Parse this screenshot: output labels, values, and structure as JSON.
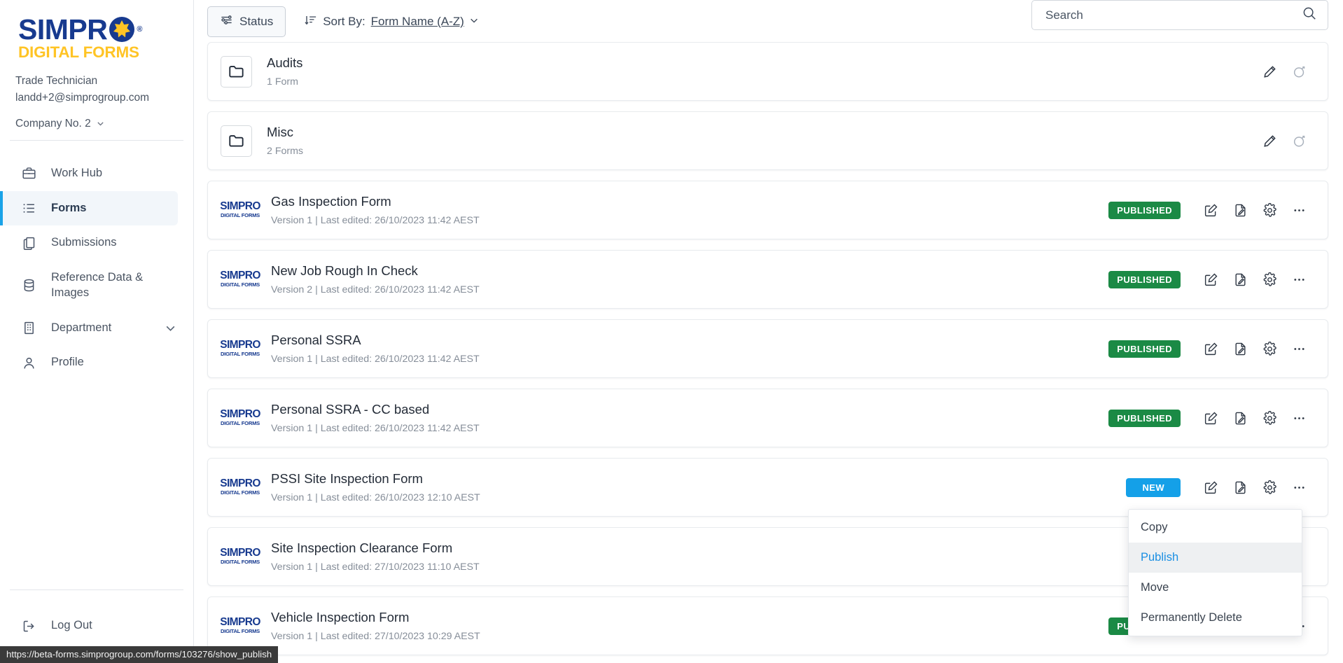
{
  "brand": {
    "name_top": "SIMPR",
    "name_reg": "®",
    "name_bottom": "DIGITAL FORMS"
  },
  "user": {
    "role": "Trade Technician",
    "email": "landd+2@simprogroup.com",
    "company": "Company No. 2"
  },
  "sidebar": {
    "items": [
      {
        "label": "Work Hub",
        "icon": "briefcase-icon",
        "active": false,
        "has_chevron": false
      },
      {
        "label": "Forms",
        "icon": "list-icon",
        "active": true,
        "has_chevron": false
      },
      {
        "label": "Submissions",
        "icon": "copy-documents-icon",
        "active": false,
        "has_chevron": false
      },
      {
        "label": "Reference Data & Images",
        "icon": "database-icon",
        "active": false,
        "has_chevron": false
      },
      {
        "label": "Department",
        "icon": "building-icon",
        "active": false,
        "has_chevron": true
      },
      {
        "label": "Profile",
        "icon": "user-icon",
        "active": false,
        "has_chevron": false
      }
    ],
    "logout": {
      "label": "Log Out",
      "icon": "logout-icon"
    }
  },
  "toolbar": {
    "status_label": "Status",
    "sort_label": "Sort By:",
    "sort_value": "Form Name (A-Z)"
  },
  "search": {
    "placeholder": "Search",
    "value": ""
  },
  "folders": [
    {
      "name": "Audits",
      "count": "1 Form"
    },
    {
      "name": "Misc",
      "count": "2 Forms"
    }
  ],
  "forms": [
    {
      "name": "Gas Inspection Form",
      "meta": "Version 1 | Last edited: 26/10/2023 11:42 AEST",
      "status": "PUBLISHED",
      "status_type": "published"
    },
    {
      "name": "New Job Rough In Check",
      "meta": "Version 2 | Last edited: 26/10/2023 11:42 AEST",
      "status": "PUBLISHED",
      "status_type": "published"
    },
    {
      "name": "Personal SSRA",
      "meta": "Version 1 | Last edited: 26/10/2023 11:42 AEST",
      "status": "PUBLISHED",
      "status_type": "published"
    },
    {
      "name": "Personal SSRA - CC based",
      "meta": "Version 1 | Last edited: 26/10/2023 11:42 AEST",
      "status": "PUBLISHED",
      "status_type": "published"
    },
    {
      "name": "PSSI Site Inspection Form",
      "meta": "Version 1 | Last edited: 26/10/2023 12:10 AEST",
      "status": "NEW",
      "status_type": "new"
    },
    {
      "name": "Site Inspection Clearance Form",
      "meta": "Version 1 | Last edited: 27/10/2023 11:10 AEST",
      "status": "",
      "status_type": "none"
    },
    {
      "name": "Vehicle Inspection Form",
      "meta": "Version 1 | Last edited: 27/10/2023 10:29 AEST",
      "status": "PUBLISHED",
      "status_type": "published"
    }
  ],
  "context_menu": {
    "items": [
      {
        "label": "Copy",
        "highlight": false
      },
      {
        "label": "Publish",
        "highlight": true
      },
      {
        "label": "Move",
        "highlight": false
      },
      {
        "label": "Permanently Delete",
        "highlight": false
      }
    ]
  },
  "status_bar": {
    "url": "https://beta-forms.simprogroup.com/forms/103276/show_publish"
  },
  "colors": {
    "brand_blue": "#173a8f",
    "brand_yellow": "#ffc425",
    "accent_blue": "#1aa3e8",
    "published_green": "#1b8a45",
    "new_blue": "#14a0e8"
  },
  "form_logo": {
    "top": "SIMPRO",
    "bottom": "DIGITAL FORMS"
  }
}
